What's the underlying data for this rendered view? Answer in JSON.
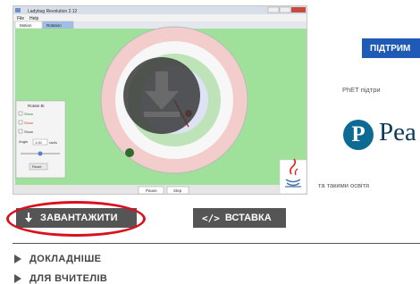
{
  "screenshot": {
    "window_title": "Ladybug Revolution 2.12",
    "menu": [
      "File",
      "Help"
    ],
    "tabs": [
      "Motion",
      "Rotation"
    ],
    "panel": {
      "title": "Rotate Bi",
      "options": [
        "Show",
        "Show",
        "Show"
      ],
      "speed_label": "Angle",
      "speed_value": "1.00",
      "speed_unit": "rad/s",
      "reset_label": "Reset"
    },
    "controls": [
      "Pause",
      "Step"
    ]
  },
  "overlay": {
    "icon": "download-arrow-icon",
    "java_icon": "java-logo-icon"
  },
  "buttons": {
    "download": "ЗАВАНТАЖИТИ",
    "embed_glyph": "</>",
    "embed": "ВСТАВКА"
  },
  "sidebar": {
    "support": "ПІДТРИМ",
    "support_text": "PhET підтри",
    "sponsor_letter": "P",
    "sponsor_name": "Pea",
    "others_text": "та такими освітя"
  },
  "sections": [
    "ДОКЛАДНІШЕ",
    "ДЛЯ ВЧИТЕЛІВ"
  ],
  "colors": {
    "highlight": "#d9101e",
    "support_button": "#1f5ab6",
    "pearson": "#0c6a93",
    "button": "#555555"
  }
}
